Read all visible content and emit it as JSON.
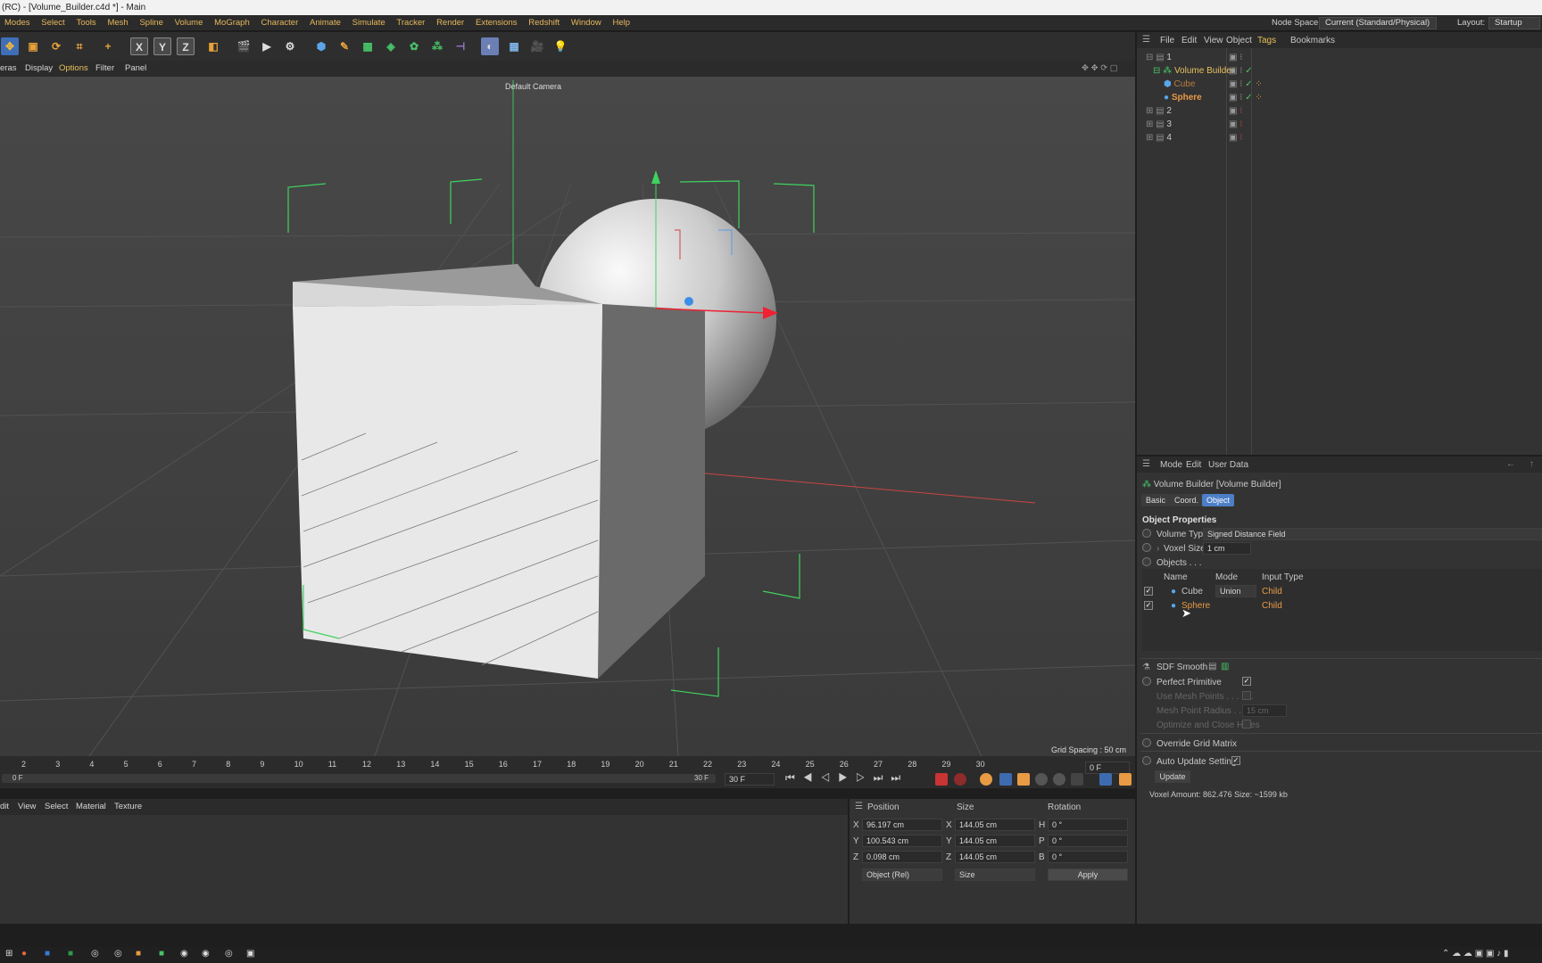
{
  "window": {
    "title": "(RC) - [Volume_Builder.c4d *] - Main"
  },
  "menu": {
    "items": [
      "Modes",
      "Select",
      "Tools",
      "Mesh",
      "Spline",
      "Volume",
      "MoGraph",
      "Character",
      "Animate",
      "Simulate",
      "Tracker",
      "Render",
      "Extensions",
      "Redshift",
      "Window",
      "Help"
    ],
    "node_space_label": "Node Space:",
    "node_space_value": "Current (Standard/Physical)",
    "layout_label": "Layout:",
    "layout_value": "Startup"
  },
  "toolbar": {
    "x_label": "X",
    "y_label": "Y",
    "z_label": "Z"
  },
  "viewport_menu": {
    "items": [
      "eras",
      "Display",
      "Options",
      "Filter",
      "Panel"
    ]
  },
  "viewport": {
    "camera_label": "Default Camera",
    "grid_spacing": "Grid Spacing : 50 cm"
  },
  "timeline": {
    "ticks": [
      "2",
      "3",
      "4",
      "5",
      "6",
      "7",
      "8",
      "9",
      "10",
      "11",
      "12",
      "13",
      "14",
      "15",
      "16",
      "17",
      "18",
      "19",
      "20",
      "21",
      "22",
      "23",
      "24",
      "25",
      "26",
      "27",
      "28",
      "29",
      "30"
    ],
    "start_frame": "0 F",
    "current_frame": "0 F",
    "end_frame": "30 F",
    "end_frame_field": "30 F"
  },
  "material": {
    "menu": [
      "dit",
      "View",
      "Select",
      "Material",
      "Texture"
    ]
  },
  "coords": {
    "headers": {
      "position": "Position",
      "size": "Size",
      "rotation": "Rotation"
    },
    "rows": [
      {
        "axis": "X",
        "pos": "96.197 cm",
        "size_axis": "X",
        "size": "144.05 cm",
        "rot_axis": "H",
        "rot": "0 °"
      },
      {
        "axis": "Y",
        "pos": "100.543 cm",
        "size_axis": "Y",
        "size": "144.05 cm",
        "rot_axis": "P",
        "rot": "0 °"
      },
      {
        "axis": "Z",
        "pos": "0.098 cm",
        "size_axis": "Z",
        "size": "144.05 cm",
        "rot_axis": "B",
        "rot": "0 °"
      }
    ],
    "mode_select": "Object (Rel)",
    "size_select": "Size",
    "apply_label": "Apply"
  },
  "object_manager": {
    "menu": [
      "File",
      "Edit",
      "View",
      "Object",
      "Tags",
      "Bookmarks"
    ],
    "rows": [
      {
        "name": "1",
        "indent": 0
      },
      {
        "name": "Volume Builder",
        "indent": 1
      },
      {
        "name": "Cube",
        "indent": 2
      },
      {
        "name": "Sphere",
        "indent": 2
      },
      {
        "name": "2",
        "indent": 0
      },
      {
        "name": "3",
        "indent": 0
      },
      {
        "name": "4",
        "indent": 0
      }
    ]
  },
  "attributes": {
    "menu": [
      "Mode",
      "Edit",
      "User Data"
    ],
    "object_title": "Volume Builder [Volume Builder]",
    "tabs": [
      "Basic",
      "Coord.",
      "Object"
    ],
    "section_title": "Object Properties",
    "volume_type_label": "Volume Type",
    "volume_type_value": "Signed Distance Field",
    "voxel_size_label": "Voxel Size",
    "voxel_size_value": "1 cm",
    "objects_label": "Objects . . .",
    "list_headers": {
      "name": "Name",
      "mode": "Mode",
      "input_type": "Input Type"
    },
    "list_rows": [
      {
        "name": "Cube",
        "mode": "Union",
        "input": "Child"
      },
      {
        "name": "Sphere",
        "mode": "",
        "input": "Child"
      }
    ],
    "sdf_smooth_label": "SDF Smooth",
    "perfect_primitive_label": "Perfect Primitive",
    "use_mesh_points_label": "Use Mesh Points . . . . . .",
    "mesh_point_radius_label": "Mesh Point Radius . . . .",
    "mesh_point_radius_value": "15 cm",
    "optimize_label": "Optimize and Close Holes",
    "override_grid_label": "Override Grid Matrix",
    "auto_update_label": "Auto Update Settings",
    "update_button": "Update",
    "voxel_amount": "Voxel Amount: 862.476   Size: ~1599 kb"
  }
}
